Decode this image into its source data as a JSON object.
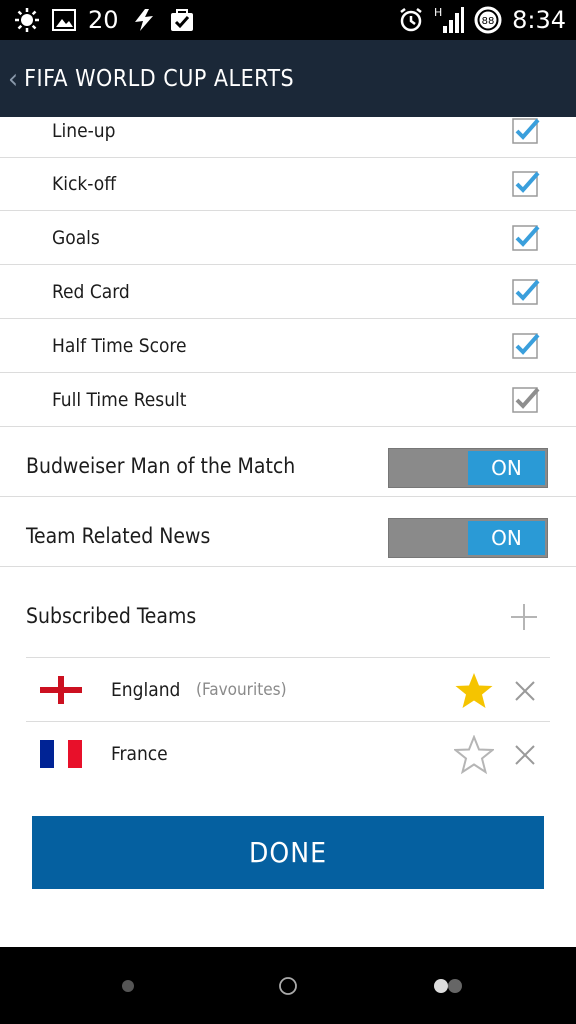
{
  "status_bar": {
    "notification_count": "20",
    "battery_level": "88",
    "time": "8:34",
    "signal_type": "H"
  },
  "header": {
    "title": "FIFA WORLD CUP ALERTS"
  },
  "alerts": [
    {
      "label": "Line-up",
      "checked": true
    },
    {
      "label": "Kick-off",
      "checked": true
    },
    {
      "label": "Goals",
      "checked": true
    },
    {
      "label": "Red Card",
      "checked": true
    },
    {
      "label": "Half Time Score",
      "checked": true
    },
    {
      "label": "Full Time Result",
      "checked": true
    }
  ],
  "toggles": [
    {
      "label": "Budweiser Man of the Match",
      "state": "ON"
    },
    {
      "label": "Team Related News",
      "state": "ON"
    }
  ],
  "subscribed": {
    "title": "Subscribed Teams",
    "teams": [
      {
        "name": "England",
        "tag": "(Favourites)",
        "favourite": true
      },
      {
        "name": "France",
        "tag": "",
        "favourite": false
      }
    ]
  },
  "done_label": "DONE",
  "colors": {
    "header_bg": "#1b2838",
    "toggle_on": "#2a9ad6",
    "done_bg": "#0560a0",
    "check_blue": "#3a9fdc",
    "star_gold": "#f5c400"
  }
}
